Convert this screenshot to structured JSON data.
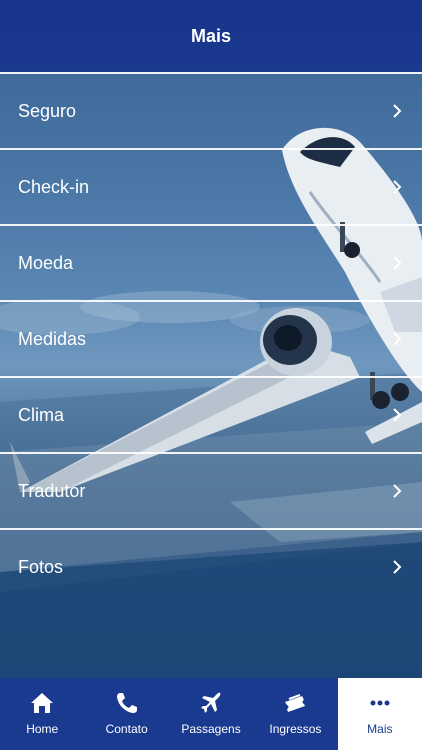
{
  "header": {
    "title": "Mais"
  },
  "menu": {
    "items": [
      {
        "label": "Seguro"
      },
      {
        "label": "Check-in"
      },
      {
        "label": "Moeda"
      },
      {
        "label": "Medidas"
      },
      {
        "label": "Clima"
      },
      {
        "label": "Tradutor"
      },
      {
        "label": "Fotos"
      }
    ]
  },
  "tabbar": {
    "tabs": [
      {
        "label": "Home",
        "icon": "home-icon"
      },
      {
        "label": "Contato",
        "icon": "phone-icon"
      },
      {
        "label": "Passagens",
        "icon": "airplane-icon"
      },
      {
        "label": "Ingressos",
        "icon": "ticket-icon"
      },
      {
        "label": "Mais",
        "icon": "more-icon",
        "active": true
      }
    ]
  },
  "colors": {
    "brand": "#1a3a8f",
    "active_tab_bg": "#ffffff",
    "text": "#ffffff"
  }
}
